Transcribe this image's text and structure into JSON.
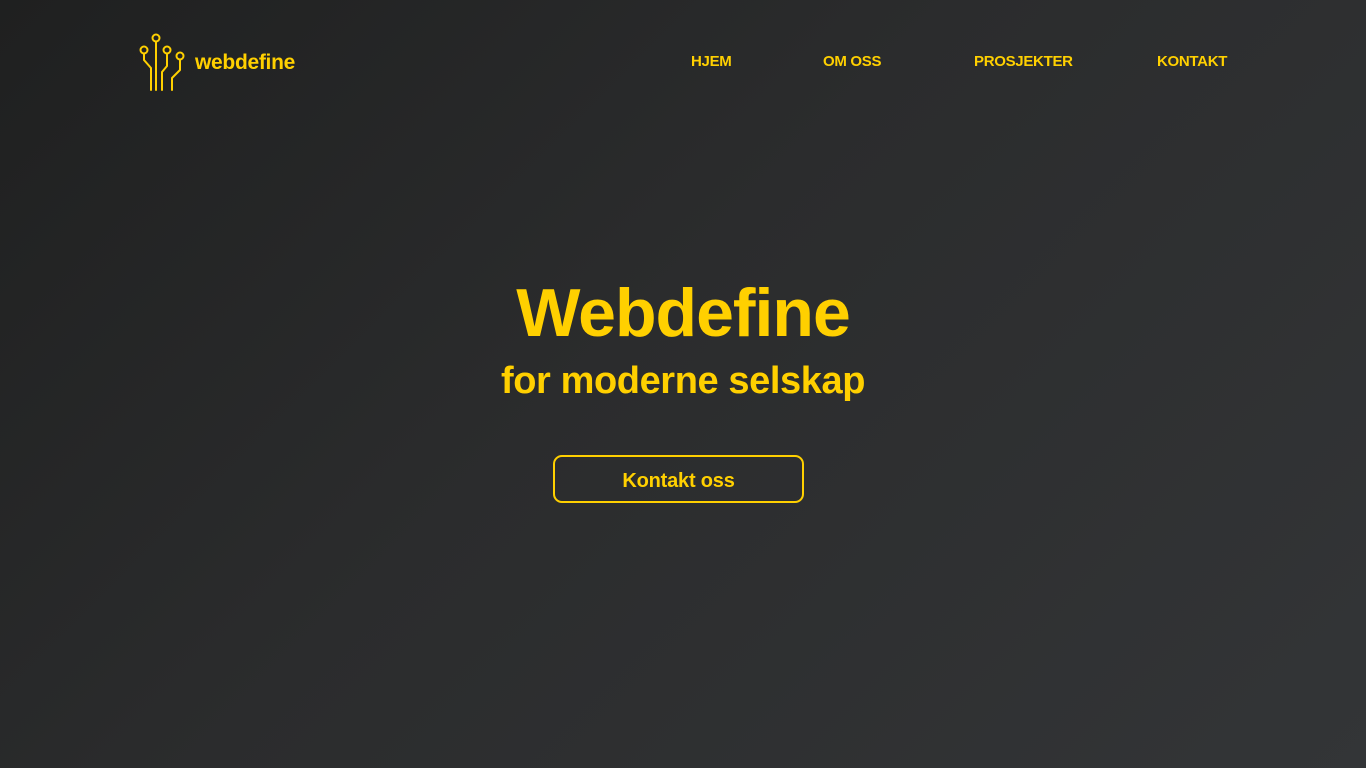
{
  "brand": {
    "name": "webdefine",
    "logo_icon": "circuit-logo-icon"
  },
  "nav": {
    "items": [
      {
        "label": "HJEM"
      },
      {
        "label": "OM OSS"
      },
      {
        "label": "PROSJEKTER"
      },
      {
        "label": "KONTAKT"
      }
    ]
  },
  "hero": {
    "title": "Webdefine",
    "subtitle": "for moderne selskap",
    "cta_label": "Kontakt oss"
  },
  "colors": {
    "accent": "#ffd000",
    "background_dark": "#1f2020",
    "background_light": "#333537"
  }
}
